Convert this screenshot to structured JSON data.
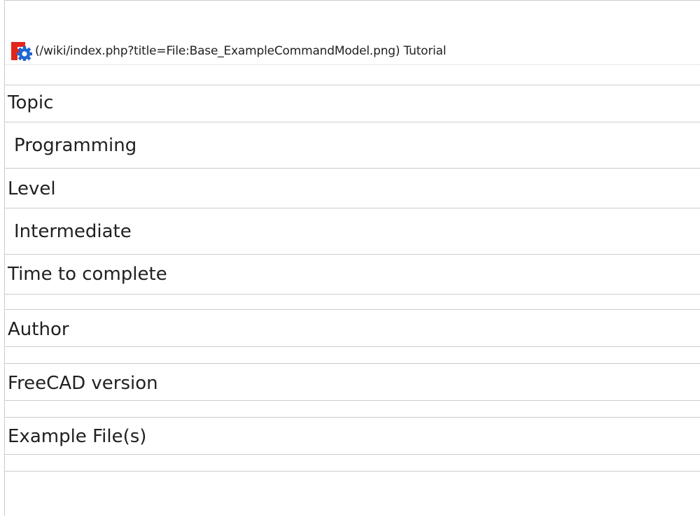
{
  "header": {
    "link_text": "(/wiki/index.php?title=File:Base_ExampleCommandModel.png)",
    "title": "Tutorial",
    "logo_icon": "freecad-logo-icon",
    "logo_colors": {
      "red": "#e2251c",
      "blue": "#1f67d2",
      "gear_white": "#ffffff"
    }
  },
  "rows": [
    {
      "label": "Topic",
      "value": "Programming"
    },
    {
      "label": "Level",
      "value": "Intermediate"
    },
    {
      "label": "Time to complete",
      "value": ""
    },
    {
      "label": "Author",
      "value": ""
    },
    {
      "label": "FreeCAD version",
      "value": ""
    },
    {
      "label": "Example File(s)",
      "value": ""
    }
  ],
  "colors": {
    "border": "#c8ccd1",
    "text": "#202122"
  }
}
